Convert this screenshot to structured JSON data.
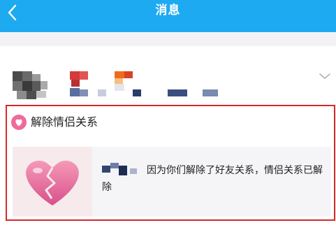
{
  "header": {
    "title": "消息",
    "back_icon": "chevron-left-icon",
    "background": "#1eaaf1"
  },
  "sender": {
    "avatar_blurred": true,
    "name_blurred": true,
    "expand_icon": "chevron-down-icon"
  },
  "notification": {
    "badge_icon": "pink-heart-icon",
    "title": "解除情侣关系",
    "thumbnail_icon": "broken-heart-icon",
    "message": "因为你们解除了好友关系，情侣关系已解除",
    "highlight_border": "#d42a2a"
  }
}
